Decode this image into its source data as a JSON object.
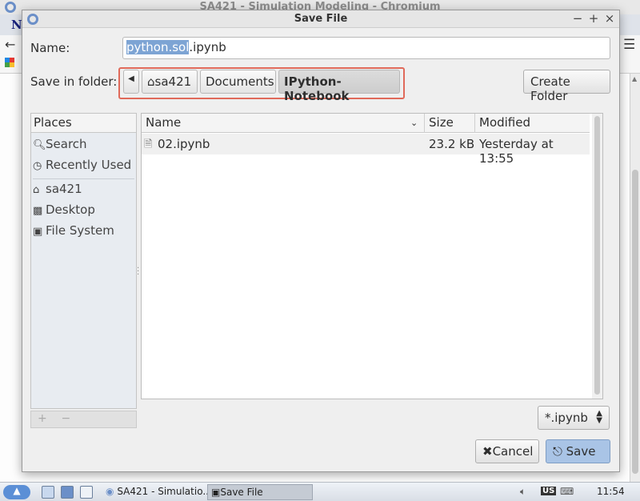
{
  "browser": {
    "title": "SA421 - Simulation Modeling - Chromium",
    "tab_char": "N"
  },
  "dialog": {
    "title": "Save File",
    "controls": {
      "minimize": "−",
      "maximize": "+",
      "close": "×"
    },
    "name_label": "Name:",
    "name_selected": "python.sol",
    "name_rest": ".ipynb",
    "save_in_label": "Save in folder:",
    "breadcrumbs": [
      "sa421",
      "Documents",
      "IPython-Notebook"
    ],
    "create_folder_label": "Create Folder",
    "places": {
      "header": "Places",
      "items": [
        {
          "label": "Search",
          "icon": "search-icon"
        },
        {
          "label": "Recently Used",
          "icon": "recent-icon"
        },
        {
          "label": "sa421",
          "icon": "home-icon"
        },
        {
          "label": "Desktop",
          "icon": "desktop-icon"
        },
        {
          "label": "File System",
          "icon": "drive-icon"
        }
      ],
      "footer_add": "+",
      "footer_remove": "−"
    },
    "files": {
      "columns": [
        "Name",
        "Size",
        "Modified"
      ],
      "rows": [
        {
          "name": "02.ipynb",
          "size": "23.2 kB",
          "modified": "Yesterday at 13:55"
        }
      ]
    },
    "filter": "*.ipynb",
    "cancel_label": "Cancel",
    "save_label": "Save"
  },
  "taskbar": {
    "tasks": [
      "SA421 - Simulatio...",
      "Save File"
    ],
    "keyboard_layout": "US",
    "time": "11:54"
  },
  "colors": {
    "highlight_border": "#e06a5a",
    "selection": "#7da4d4",
    "save_button": "#a9c4e6"
  }
}
